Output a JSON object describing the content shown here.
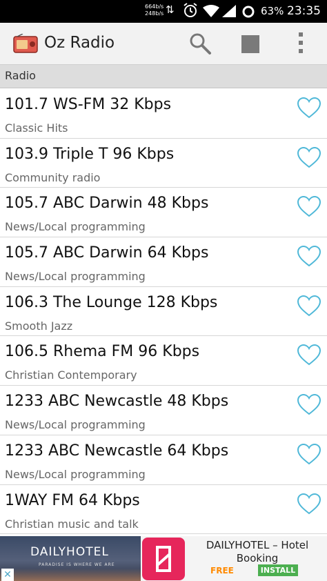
{
  "status_bar": {
    "speed_up": "664b/s",
    "speed_down": "248b/s",
    "battery": "63%",
    "time": "23:35"
  },
  "app_bar": {
    "title": "Oz Radio",
    "icons": [
      "radio-app-icon",
      "search-icon",
      "stop-icon",
      "overflow-menu-icon"
    ]
  },
  "section": {
    "header": "Radio"
  },
  "stations": [
    {
      "name": "101.7 WS-FM 32 Kbps",
      "genre": "Classic Hits"
    },
    {
      "name": "103.9 Triple T 96 Kbps",
      "genre": "Community radio"
    },
    {
      "name": "105.7 ABC Darwin 48 Kbps",
      "genre": "News/Local programming"
    },
    {
      "name": "105.7 ABC Darwin 64 Kbps",
      "genre": "News/Local programming"
    },
    {
      "name": "106.3 The Lounge 128 Kbps",
      "genre": "Smooth Jazz"
    },
    {
      "name": "106.5 Rhema FM 96 Kbps",
      "genre": "Christian Contemporary"
    },
    {
      "name": "1233 ABC Newcastle 48 Kbps",
      "genre": "News/Local programming"
    },
    {
      "name": "1233 ABC Newcastle 64 Kbps",
      "genre": "News/Local programming"
    },
    {
      "name": "1WAY FM 64 Kbps",
      "genre": "Christian music and talk"
    }
  ],
  "ad": {
    "brand": "DAILYHOTEL",
    "tagline": "PARADISE IS WHERE WE ARE",
    "title": "DAILYHOTEL – Hotel Booking",
    "price": "FREE",
    "install_label": "INSTALL",
    "close_glyph": "✕"
  },
  "colors": {
    "accent_heart": "#4fb8d8",
    "action_bar": "#f2f2f2",
    "section_header": "#dddddd",
    "install_button": "#4caf50",
    "free_label": "#ff8a00",
    "ad_logo": "#e6265b"
  }
}
